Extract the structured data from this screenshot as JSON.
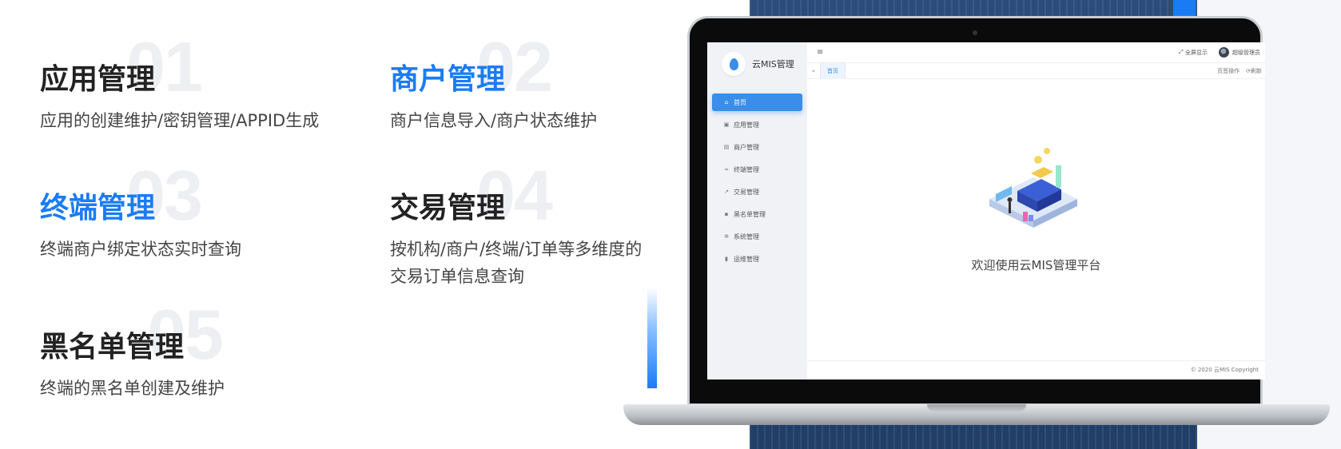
{
  "features": [
    {
      "num": "01",
      "title": "应用管理",
      "desc": "应用的创建维护/密钥管理/APPID生成"
    },
    {
      "num": "02",
      "title": "商户管理",
      "desc": "商户信息导入/商户状态维护"
    },
    {
      "num": "03",
      "title": "终端管理",
      "desc": "终端商户绑定状态实时查询"
    },
    {
      "num": "04",
      "title": "交易管理",
      "desc_line1": "按机构/商户/终端/订单等多维度的",
      "desc_line2": "交易订单信息查询"
    },
    {
      "num": "05",
      "title": "黑名单管理",
      "desc": "终端的黑名单创建及维护"
    }
  ],
  "colors": {
    "accent": "#1a7cf5",
    "title": "#222222",
    "number_watermark": "#eeeff2",
    "nav_active": "#3a8de8"
  },
  "screen": {
    "logo_text": "云MIS管理",
    "nav": [
      {
        "label": "首页",
        "icon": "home-icon"
      },
      {
        "label": "应用管理",
        "icon": "app-icon"
      },
      {
        "label": "商户管理",
        "icon": "merchant-icon"
      },
      {
        "label": "终端管理",
        "icon": "wifi-icon"
      },
      {
        "label": "交易管理",
        "icon": "chart-icon"
      },
      {
        "label": "黑名单管理",
        "icon": "blacklist-icon"
      },
      {
        "label": "系统管理",
        "icon": "gear-icon"
      },
      {
        "label": "运维管理",
        "icon": "doc-icon"
      }
    ],
    "topbar": {
      "menu_icon": "≡",
      "fullscreen": "全屏显示",
      "user": "超级管理员"
    },
    "tabbar": {
      "back_icon": "«",
      "tab": "首页",
      "page_ops": "页签操作",
      "refresh": "刷新"
    },
    "welcome": "欢迎使用云MIS管理平台",
    "footer": "© 2020 云MIS Copyright"
  }
}
